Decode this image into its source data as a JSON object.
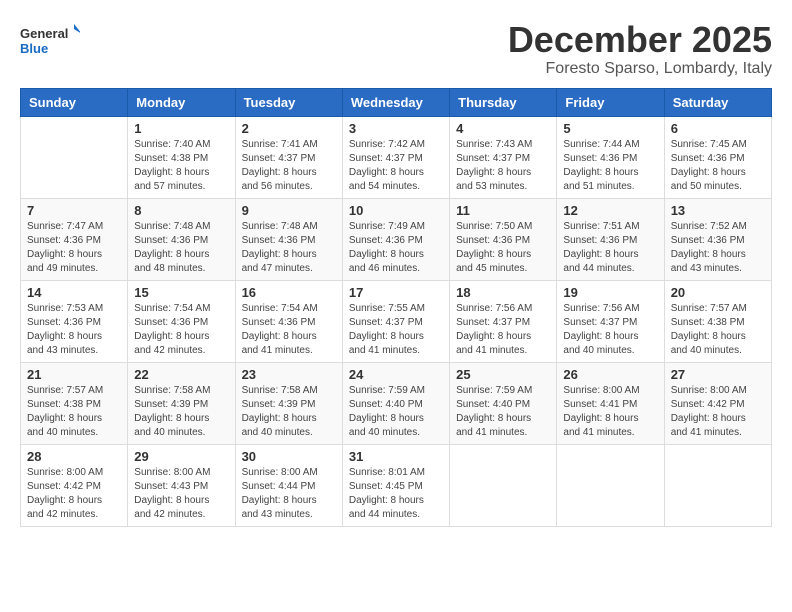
{
  "header": {
    "logo_general": "General",
    "logo_blue": "Blue",
    "month_title": "December 2025",
    "location": "Foresto Sparso, Lombardy, Italy"
  },
  "weekdays": [
    "Sunday",
    "Monday",
    "Tuesday",
    "Wednesday",
    "Thursday",
    "Friday",
    "Saturday"
  ],
  "weeks": [
    [
      {
        "day": "",
        "info": ""
      },
      {
        "day": "1",
        "info": "Sunrise: 7:40 AM\nSunset: 4:38 PM\nDaylight: 8 hours\nand 57 minutes."
      },
      {
        "day": "2",
        "info": "Sunrise: 7:41 AM\nSunset: 4:37 PM\nDaylight: 8 hours\nand 56 minutes."
      },
      {
        "day": "3",
        "info": "Sunrise: 7:42 AM\nSunset: 4:37 PM\nDaylight: 8 hours\nand 54 minutes."
      },
      {
        "day": "4",
        "info": "Sunrise: 7:43 AM\nSunset: 4:37 PM\nDaylight: 8 hours\nand 53 minutes."
      },
      {
        "day": "5",
        "info": "Sunrise: 7:44 AM\nSunset: 4:36 PM\nDaylight: 8 hours\nand 51 minutes."
      },
      {
        "day": "6",
        "info": "Sunrise: 7:45 AM\nSunset: 4:36 PM\nDaylight: 8 hours\nand 50 minutes."
      }
    ],
    [
      {
        "day": "7",
        "info": "Sunrise: 7:47 AM\nSunset: 4:36 PM\nDaylight: 8 hours\nand 49 minutes."
      },
      {
        "day": "8",
        "info": "Sunrise: 7:48 AM\nSunset: 4:36 PM\nDaylight: 8 hours\nand 48 minutes."
      },
      {
        "day": "9",
        "info": "Sunrise: 7:48 AM\nSunset: 4:36 PM\nDaylight: 8 hours\nand 47 minutes."
      },
      {
        "day": "10",
        "info": "Sunrise: 7:49 AM\nSunset: 4:36 PM\nDaylight: 8 hours\nand 46 minutes."
      },
      {
        "day": "11",
        "info": "Sunrise: 7:50 AM\nSunset: 4:36 PM\nDaylight: 8 hours\nand 45 minutes."
      },
      {
        "day": "12",
        "info": "Sunrise: 7:51 AM\nSunset: 4:36 PM\nDaylight: 8 hours\nand 44 minutes."
      },
      {
        "day": "13",
        "info": "Sunrise: 7:52 AM\nSunset: 4:36 PM\nDaylight: 8 hours\nand 43 minutes."
      }
    ],
    [
      {
        "day": "14",
        "info": "Sunrise: 7:53 AM\nSunset: 4:36 PM\nDaylight: 8 hours\nand 43 minutes."
      },
      {
        "day": "15",
        "info": "Sunrise: 7:54 AM\nSunset: 4:36 PM\nDaylight: 8 hours\nand 42 minutes."
      },
      {
        "day": "16",
        "info": "Sunrise: 7:54 AM\nSunset: 4:36 PM\nDaylight: 8 hours\nand 41 minutes."
      },
      {
        "day": "17",
        "info": "Sunrise: 7:55 AM\nSunset: 4:37 PM\nDaylight: 8 hours\nand 41 minutes."
      },
      {
        "day": "18",
        "info": "Sunrise: 7:56 AM\nSunset: 4:37 PM\nDaylight: 8 hours\nand 41 minutes."
      },
      {
        "day": "19",
        "info": "Sunrise: 7:56 AM\nSunset: 4:37 PM\nDaylight: 8 hours\nand 40 minutes."
      },
      {
        "day": "20",
        "info": "Sunrise: 7:57 AM\nSunset: 4:38 PM\nDaylight: 8 hours\nand 40 minutes."
      }
    ],
    [
      {
        "day": "21",
        "info": "Sunrise: 7:57 AM\nSunset: 4:38 PM\nDaylight: 8 hours\nand 40 minutes."
      },
      {
        "day": "22",
        "info": "Sunrise: 7:58 AM\nSunset: 4:39 PM\nDaylight: 8 hours\nand 40 minutes."
      },
      {
        "day": "23",
        "info": "Sunrise: 7:58 AM\nSunset: 4:39 PM\nDaylight: 8 hours\nand 40 minutes."
      },
      {
        "day": "24",
        "info": "Sunrise: 7:59 AM\nSunset: 4:40 PM\nDaylight: 8 hours\nand 40 minutes."
      },
      {
        "day": "25",
        "info": "Sunrise: 7:59 AM\nSunset: 4:40 PM\nDaylight: 8 hours\nand 41 minutes."
      },
      {
        "day": "26",
        "info": "Sunrise: 8:00 AM\nSunset: 4:41 PM\nDaylight: 8 hours\nand 41 minutes."
      },
      {
        "day": "27",
        "info": "Sunrise: 8:00 AM\nSunset: 4:42 PM\nDaylight: 8 hours\nand 41 minutes."
      }
    ],
    [
      {
        "day": "28",
        "info": "Sunrise: 8:00 AM\nSunset: 4:42 PM\nDaylight: 8 hours\nand 42 minutes."
      },
      {
        "day": "29",
        "info": "Sunrise: 8:00 AM\nSunset: 4:43 PM\nDaylight: 8 hours\nand 42 minutes."
      },
      {
        "day": "30",
        "info": "Sunrise: 8:00 AM\nSunset: 4:44 PM\nDaylight: 8 hours\nand 43 minutes."
      },
      {
        "day": "31",
        "info": "Sunrise: 8:01 AM\nSunset: 4:45 PM\nDaylight: 8 hours\nand 44 minutes."
      },
      {
        "day": "",
        "info": ""
      },
      {
        "day": "",
        "info": ""
      },
      {
        "day": "",
        "info": ""
      }
    ]
  ]
}
